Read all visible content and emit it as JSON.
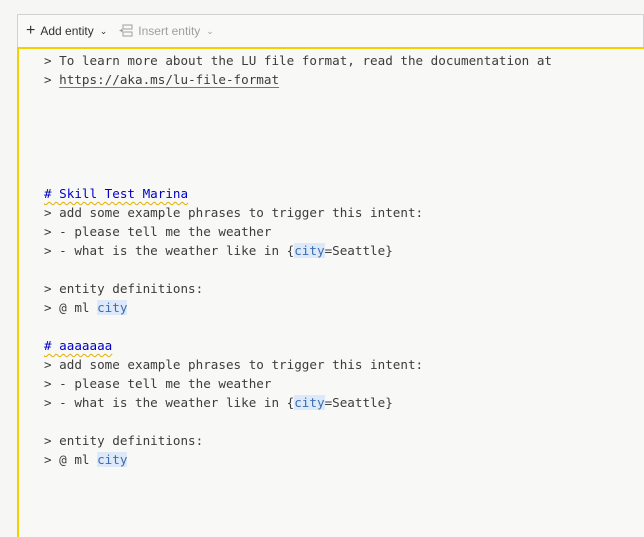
{
  "toolbar": {
    "add_entity_label": "Add entity",
    "insert_entity_label": "Insert entity"
  },
  "editor": {
    "doc_prefix": "> To learn more about the LU file format, read the documentation at",
    "doc_link_prefix": "> ",
    "doc_link": "https://aka.ms/lu-file-format",
    "intents": [
      {
        "heading": "# Skill Test Marina",
        "comment": "> add some example phrases to trigger this intent:",
        "ex1": "> - please tell me the weather",
        "ex2_pre": "> - what is the weather like in {",
        "ex2_entity": "city",
        "ex2_post": "=Seattle}",
        "entity_header": "> entity definitions:",
        "entity_def_pre": "> @ ml ",
        "entity_def_name": "city"
      },
      {
        "heading": "# aaaaaaa",
        "comment": "> add some example phrases to trigger this intent:",
        "ex1": "> - please tell me the weather",
        "ex2_pre": "> - what is the weather like in {",
        "ex2_entity": "city",
        "ex2_post": "=Seattle}",
        "entity_header": "> entity definitions:",
        "entity_def_pre": "> @ ml ",
        "entity_def_name": "city"
      }
    ]
  },
  "colors": {
    "focus_border": "#f5d000",
    "heading": "#0000c8",
    "entity_bg": "#dde9f8"
  }
}
